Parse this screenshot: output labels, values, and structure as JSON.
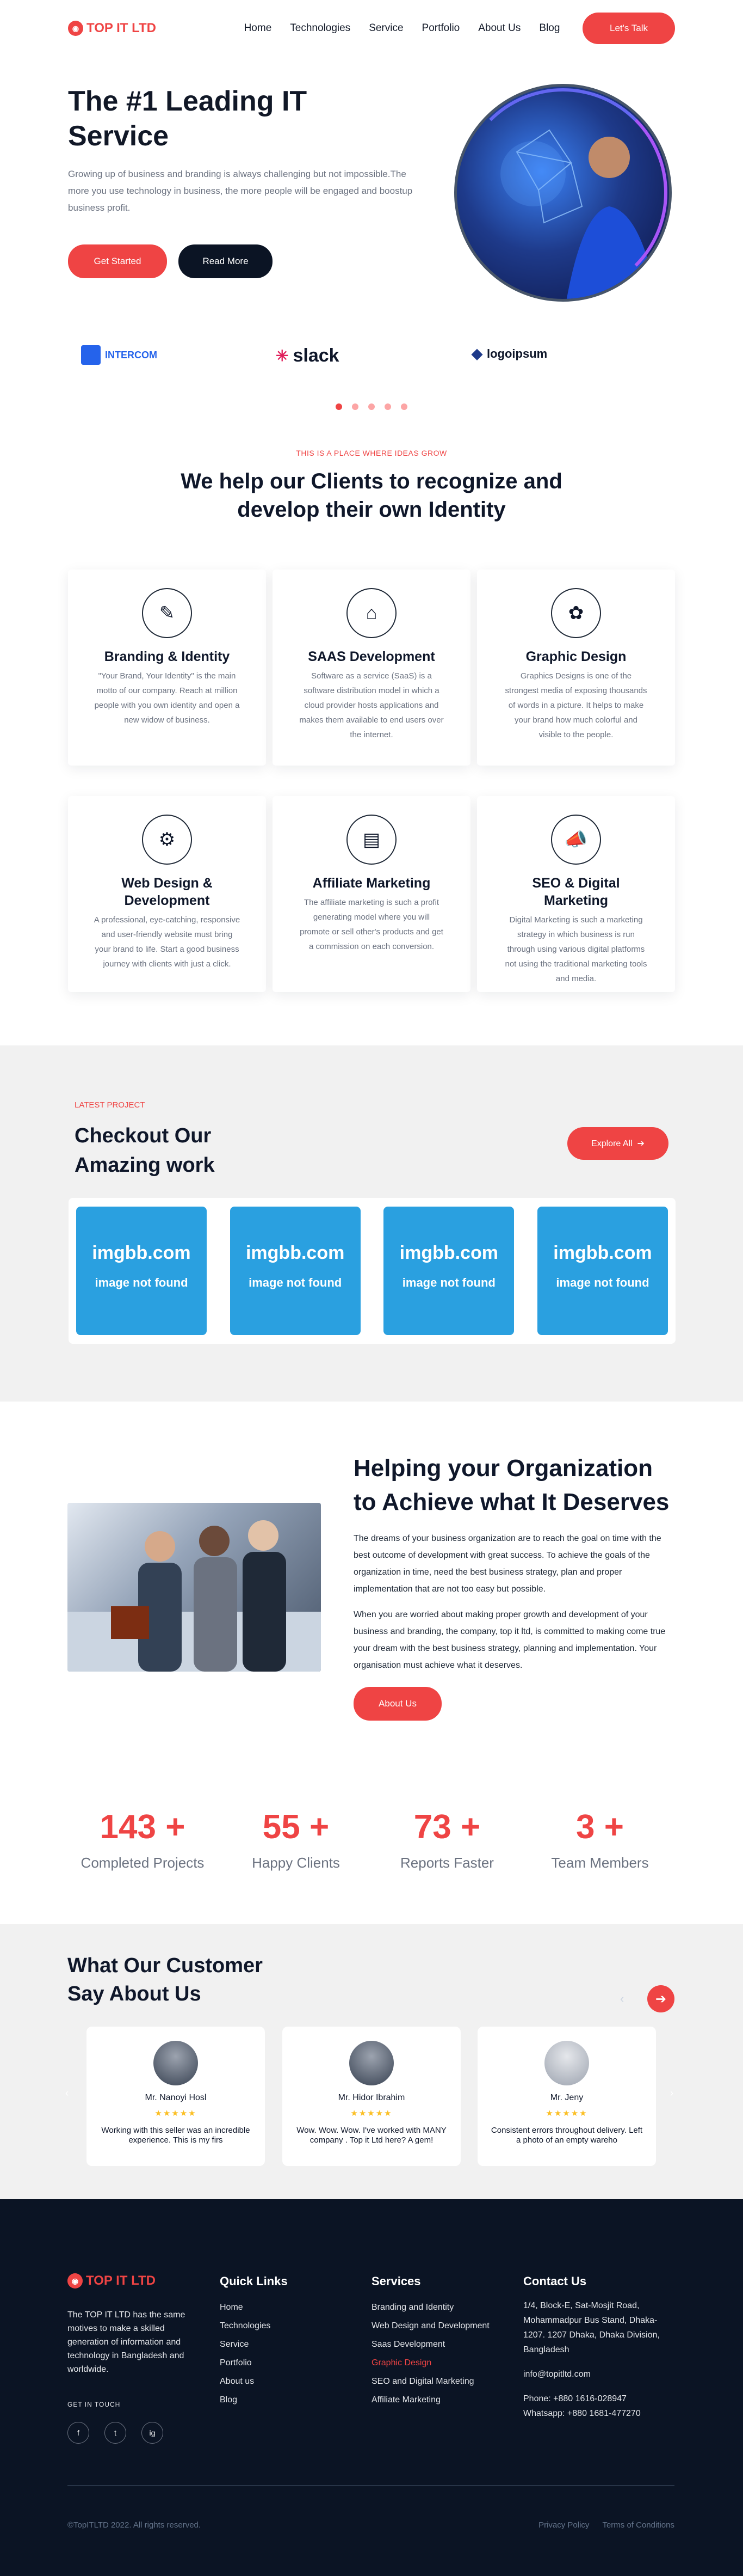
{
  "brand": {
    "name": "TOP IT LTD",
    "accent": "#ef4444",
    "dark": "#0b1424"
  },
  "nav": {
    "items": [
      "Home",
      "Technologies",
      "Service",
      "Portfolio",
      "About Us",
      "Blog"
    ],
    "cta": "Let's Talk"
  },
  "hero": {
    "title": "The #1 Leading IT Service",
    "text": "Growing up of business and branding is always challenging but not impossible.The more you use technology in business, the more people will be engaged and boostup business profit.",
    "primary_button": "Get Started",
    "secondary_button": "Read More"
  },
  "brands": [
    "INTERCOM",
    "slack",
    "logoipsum"
  ],
  "carousel": {
    "dots": 5,
    "active": 0
  },
  "services": {
    "eyebrow": "THIS IS A PLACE WHERE IDEAS GROW",
    "title": "We help our Clients to recognize and develop their own Identity",
    "items": [
      {
        "title": "Branding & Identity",
        "icon": "branding-icon",
        "text": "\"Your Brand, Your Identity\" is the main motto of our company. Reach at million people with you own identity and open a new widow of business."
      },
      {
        "title": "SAAS Development",
        "icon": "saas-icon",
        "text": "Software as a service (SaaS) is a software distribution model in which a cloud provider hosts applications and makes them available to end users over the internet."
      },
      {
        "title": "Graphic Design",
        "icon": "graphic-design-icon",
        "text": "Graphics Designs is one of the strongest media of exposing thousands of words in a picture. It helps to make your brand how much colorful and visible to the people."
      },
      {
        "title": "Web Design & Development",
        "icon": "web-design-icon",
        "text": "A professional, eye-catching, responsive and user-friendly website must bring your brand to life. Start a good business journey with clients with just a click."
      },
      {
        "title": "Affiliate Marketing",
        "icon": "affiliate-icon",
        "text": "The affiliate marketing is such a profit generating model where you will promote or sell other's products and get a commission on each conversion."
      },
      {
        "title": "SEO & Digital Marketing",
        "icon": "megaphone-icon",
        "text": "Digital Marketing is such a marketing strategy in which business is run through using various digital platforms not using the traditional marketing tools and media."
      }
    ]
  },
  "projects": {
    "eyebrow": "LATEST PROJECT",
    "title": "Checkout Our Amazing work",
    "button": "Explore All",
    "items": [
      {
        "line1": "imgbb.com",
        "line2": "image not found"
      },
      {
        "line1": "imgbb.com",
        "line2": "image not found"
      },
      {
        "line1": "imgbb.com",
        "line2": "image not found"
      },
      {
        "line1": "imgbb.com",
        "line2": "image not found"
      }
    ]
  },
  "about": {
    "title": "Helping your Organization to Achieve what It Deserves",
    "p1": "The dreams of your business organization are to reach the goal on time with the best outcome of development with great success. To achieve the goals of the organization in time, need the best business strategy, plan and proper implementation that are not too easy but possible.",
    "p2": "When you are worried about making proper growth and development of your business and branding, the company, top it ltd, is committed to making come true your dream with the best business strategy, planning and implementation. Your organisation must achieve what it deserves.",
    "button": "About Us"
  },
  "stats": [
    {
      "number": "143 +",
      "label": "Completed Projects"
    },
    {
      "number": "55 +",
      "label": "Happy Clients"
    },
    {
      "number": "73 +",
      "label": "Reports Faster"
    },
    {
      "number": "3 +",
      "label": "Team Members"
    }
  ],
  "testimonials": {
    "title": "What Our Customer Say About Us",
    "items": [
      {
        "name": "Mr. Nanoyi Hosl",
        "stars": "★★★★★",
        "quote": "Working with this seller was an incredible experience. This is my firs"
      },
      {
        "name": "Mr. Hidor Ibrahim",
        "stars": "★★★★★",
        "quote": "Wow. Wow. Wow. I've worked with MANY company . Top it Ltd here? A gem!"
      },
      {
        "name": "Mr. Jeny",
        "stars": "★★★★★",
        "quote": "Consistent errors throughout delivery. Left a photo of an empty wareho"
      }
    ]
  },
  "footer": {
    "about": "The TOP IT LTD has the same motives to make a skilled generation of information and technology in Bangladesh and worldwide.",
    "get_in_touch": "GET IN TOUCH",
    "social": [
      "f",
      "t",
      "ig"
    ],
    "quick_links": {
      "title": "Quick Links",
      "items": [
        "Home",
        "Technologies",
        "Service",
        "Portfolio",
        "About us",
        "Blog"
      ]
    },
    "services": {
      "title": "Services",
      "items": [
        "Branding and Identity",
        "Web Design and Development",
        "Saas Development",
        "Graphic Design",
        "SEO and Digital Marketing",
        "Affiliate Marketing"
      ]
    },
    "contact": {
      "title": "Contact Us",
      "address": "1/4, Block-E, Sat-Mosjit Road, Mohammadpur Bus Stand, Dhaka-1207. 1207 Dhaka, Dhaka Division, Bangladesh",
      "email": "info@topitltd.com",
      "phone": "Phone: +880 1616-028947",
      "whatsapp": "Whatsapp: +880 1681-477270"
    },
    "copyright": "©TopITLTD 2022. All rights reserved.",
    "legal": [
      "Privacy Policy",
      "Terms of Conditions"
    ]
  }
}
